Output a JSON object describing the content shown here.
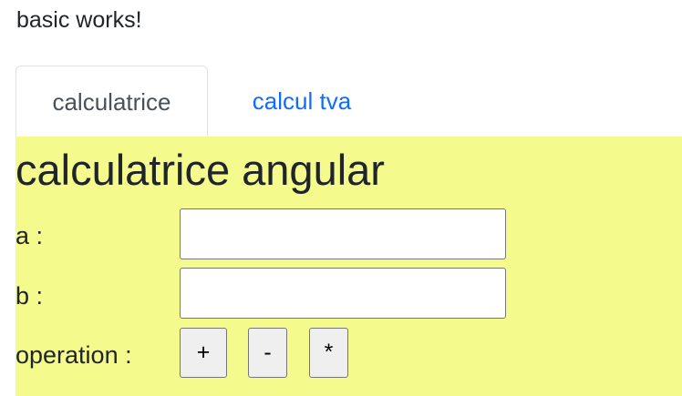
{
  "header": {
    "status_text": "basic works!"
  },
  "tabs": [
    {
      "label": "calculatrice",
      "active": true
    },
    {
      "label": "calcul tva",
      "active": false
    }
  ],
  "panel": {
    "background": "#f4fb8c",
    "title": "calculatrice angular",
    "fields": [
      {
        "label": "a :",
        "value": ""
      },
      {
        "label": "b :",
        "value": ""
      }
    ],
    "operation": {
      "label": "operation :",
      "buttons": [
        "+",
        "-",
        "*"
      ]
    }
  },
  "colors": {
    "link": "#0d6efd",
    "text": "#212529",
    "tab_border": "#dee2e6"
  }
}
